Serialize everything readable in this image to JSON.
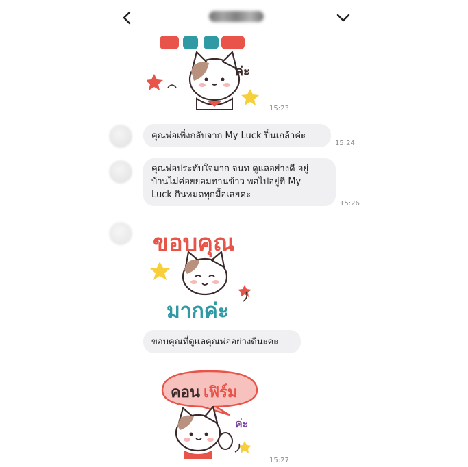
{
  "header": {
    "back_icon": "chevron-left-icon",
    "menu_icon": "chevron-down-icon"
  },
  "messages": [
    {
      "type": "sticker",
      "sticker": "cat-sticker-top",
      "time": "15:23"
    },
    {
      "type": "text",
      "text": "คุณพ่อเพิ่งกลับจาก My Luck ปิ่นเกล้าค่ะ",
      "time": "15:24"
    },
    {
      "type": "text",
      "lines": [
        "คุณพ่อประทับใจมาก จนท ดูแลอย่างดี อยู่",
        "บ้านไม่ค่อยยอมทานข้าว พอไปอยู่ที่ My",
        "Luck กินหมดทุกมื้อเลยค่ะ"
      ],
      "time": "15:26"
    },
    {
      "type": "sticker",
      "sticker": "cat-sticker-thank-you",
      "line1": "ขอบคุณ",
      "line2": "มากค่ะ"
    },
    {
      "type": "text",
      "text": "ขอบคุณที่ดูแลคุณพ่ออย่างดีนะคะ"
    },
    {
      "type": "sticker",
      "sticker": "cat-sticker-confirm",
      "word1": "คอน",
      "word2": "เฟิร์ม",
      "suffix": "ค่ะ",
      "time": "15:27"
    }
  ],
  "colors": {
    "bubble": "#f0f0f2",
    "time": "#8a8a8a",
    "sticker_red": "#e8534a",
    "sticker_teal": "#2f9aa3",
    "sticker_purple": "#7a3fa0",
    "star_yellow": "#f6cf3a"
  }
}
